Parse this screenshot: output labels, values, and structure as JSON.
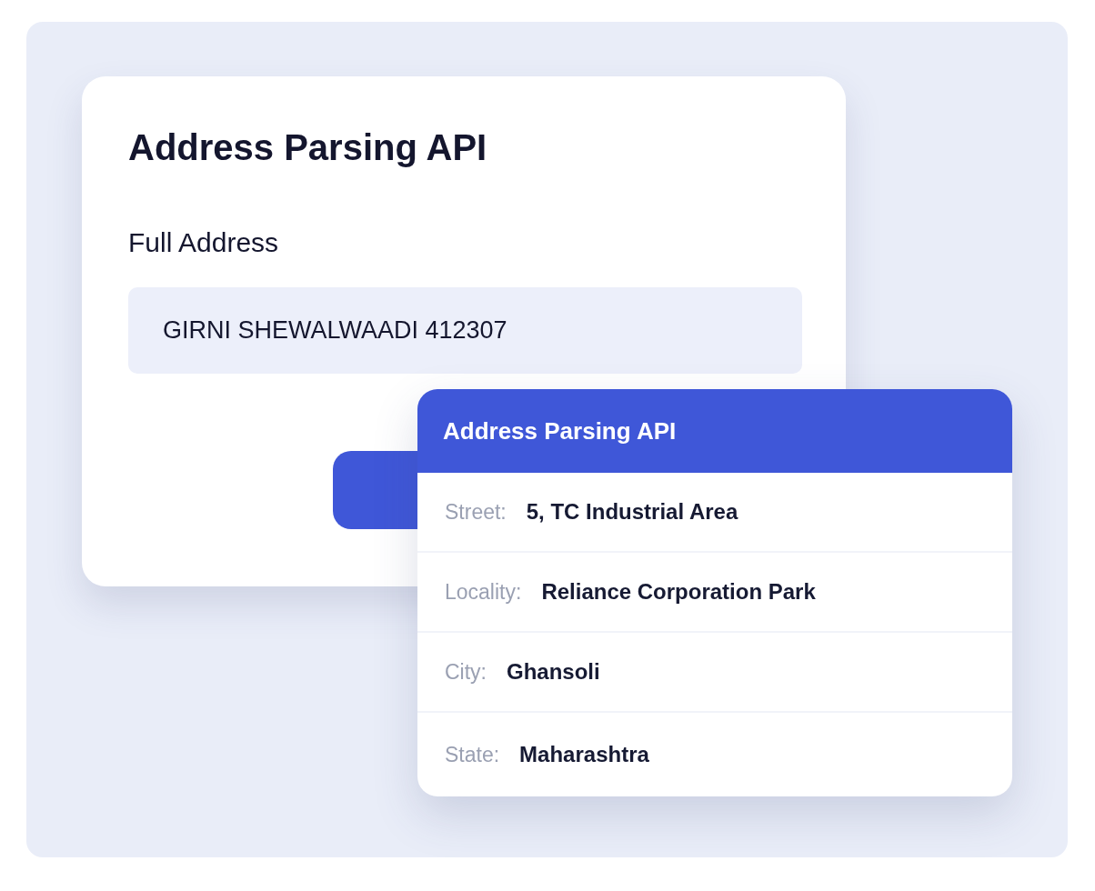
{
  "form_card": {
    "title": "Address Parsing API",
    "field": {
      "label": "Full Address",
      "value": "GIRNI SHEWALWAADI 412307"
    }
  },
  "result_card": {
    "title": "Address Parsing API",
    "rows": [
      {
        "label": "Street:",
        "value": "5, TC Industrial Area"
      },
      {
        "label": "Locality:",
        "value": "Reliance Corporation Park"
      },
      {
        "label": "City:",
        "value": "Ghansoli"
      },
      {
        "label": "State:",
        "value": "Maharashtra"
      }
    ]
  }
}
